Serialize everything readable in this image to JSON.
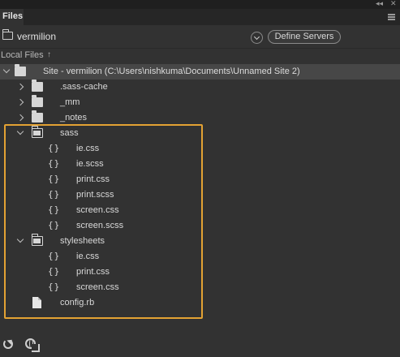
{
  "panel": {
    "tab_label": "Files",
    "collapse_glyph": "◂◂",
    "close_glyph": "✕",
    "menu_icon": "panel-menu-icon"
  },
  "site_bar": {
    "site_name": "vermilion",
    "define_servers_label": "Define Servers"
  },
  "local_files": {
    "header_label": "Local Files",
    "sort_glyph": "↑"
  },
  "tree": {
    "root": {
      "label": "Site - vermilion (C:\\Users\\nishkuma\\Documents\\Unnamed Site 2)"
    },
    "items": [
      {
        "label": ".sass-cache",
        "kind": "folder"
      },
      {
        "label": "_mm",
        "kind": "folder"
      },
      {
        "label": "_notes",
        "kind": "folder"
      },
      {
        "label": "sass",
        "kind": "folder-open"
      },
      {
        "label": "ie.css",
        "kind": "code"
      },
      {
        "label": "ie.scss",
        "kind": "code"
      },
      {
        "label": "print.css",
        "kind": "code"
      },
      {
        "label": "print.scss",
        "kind": "code"
      },
      {
        "label": "screen.css",
        "kind": "code"
      },
      {
        "label": "screen.scss",
        "kind": "code"
      },
      {
        "label": "stylesheets",
        "kind": "folder-open"
      },
      {
        "label": "ie.css",
        "kind": "code"
      },
      {
        "label": "print.css",
        "kind": "code"
      },
      {
        "label": "screen.css",
        "kind": "code"
      },
      {
        "label": "config.rb",
        "kind": "file"
      }
    ],
    "code_glyph": "{}"
  },
  "colors": {
    "panel_bg": "#323232",
    "root_row_bg": "#474747",
    "highlight_border": "#e3a233"
  },
  "bottom_bar": {
    "refresh_icon": "refresh-icon",
    "globe_icon": "connect-globe-icon"
  }
}
